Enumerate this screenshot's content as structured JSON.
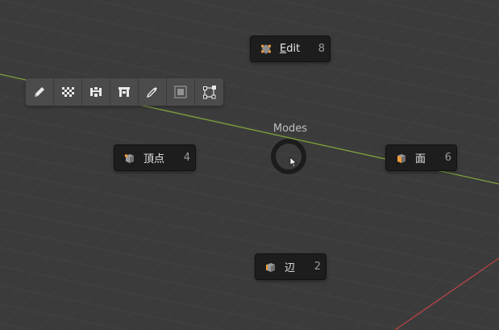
{
  "pie_menu": {
    "title": "Modes",
    "items": [
      {
        "label": "Edit",
        "shortcut": "8",
        "icon": "edit-mode-icon"
      },
      {
        "label": "頂点",
        "shortcut": "4",
        "icon": "vertex-select-icon"
      },
      {
        "label": "面",
        "shortcut": "6",
        "icon": "face-select-icon"
      },
      {
        "label": "辺",
        "shortcut": "2",
        "icon": "edge-select-icon"
      }
    ]
  },
  "toolbar": {
    "tools": [
      "pencil-icon",
      "checker-icon",
      "edge-loop-icon",
      "bridge-icon",
      "eyedropper-icon",
      "frame-disabled-icon",
      "transform-icon"
    ]
  },
  "colors": {
    "grid_background": "#3b3b3b",
    "x_axis": "#b84444",
    "y_axis": "#7ea13c",
    "face_icon_accent": "#f29a38"
  }
}
